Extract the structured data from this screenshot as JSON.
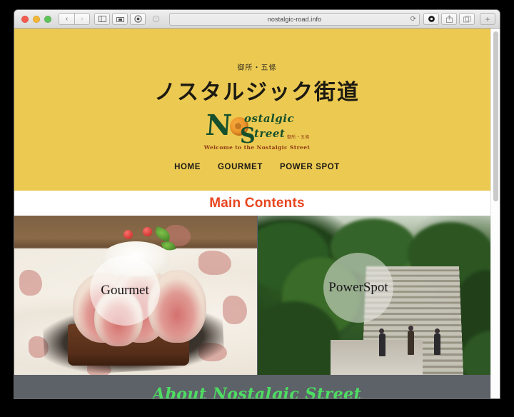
{
  "browser": {
    "url": "nostalgic-road.info",
    "traffic_lights": [
      "close",
      "minimize",
      "zoom"
    ],
    "back_label": "‹",
    "forward_label": "›",
    "sidebar_icon": "sidebar-icon",
    "tabview_icon": "tab-overview-icon",
    "privacy_icon": "shield-icon",
    "history_icon": "clock-icon",
    "reload_label": "⟳",
    "reader_label": "◉",
    "share_label": "⇪",
    "tabs_label": "⧉",
    "newtab_label": "+"
  },
  "site": {
    "kicker": "御所・五條",
    "title": "ノスタルジック街道",
    "logo": {
      "letter_n": "N",
      "ostalgic": "ostalgic",
      "letter_s": "S",
      "street": "treet",
      "jp_mark": "御所・五條",
      "tagline": "Welcome to the Nostalgic Street"
    },
    "nav": [
      {
        "label": "HOME"
      },
      {
        "label": "GOURMET"
      },
      {
        "label": "POWER SPOT"
      }
    ],
    "main_contents_heading": "Main Contents",
    "tiles": [
      {
        "label": "Gourmet",
        "alt": "fig-tart-dessert-photo"
      },
      {
        "label": "PowerSpot",
        "alt": "stone-stairway-forest-photo"
      }
    ],
    "about_heading": "About Nostalgic Street"
  },
  "colors": {
    "header_yellow": "#ecca52",
    "heading_red": "#e8451f",
    "about_bg": "#5d6168",
    "about_green": "#4ddd62",
    "logo_green": "#17502c",
    "logo_orange": "#e3821c"
  }
}
